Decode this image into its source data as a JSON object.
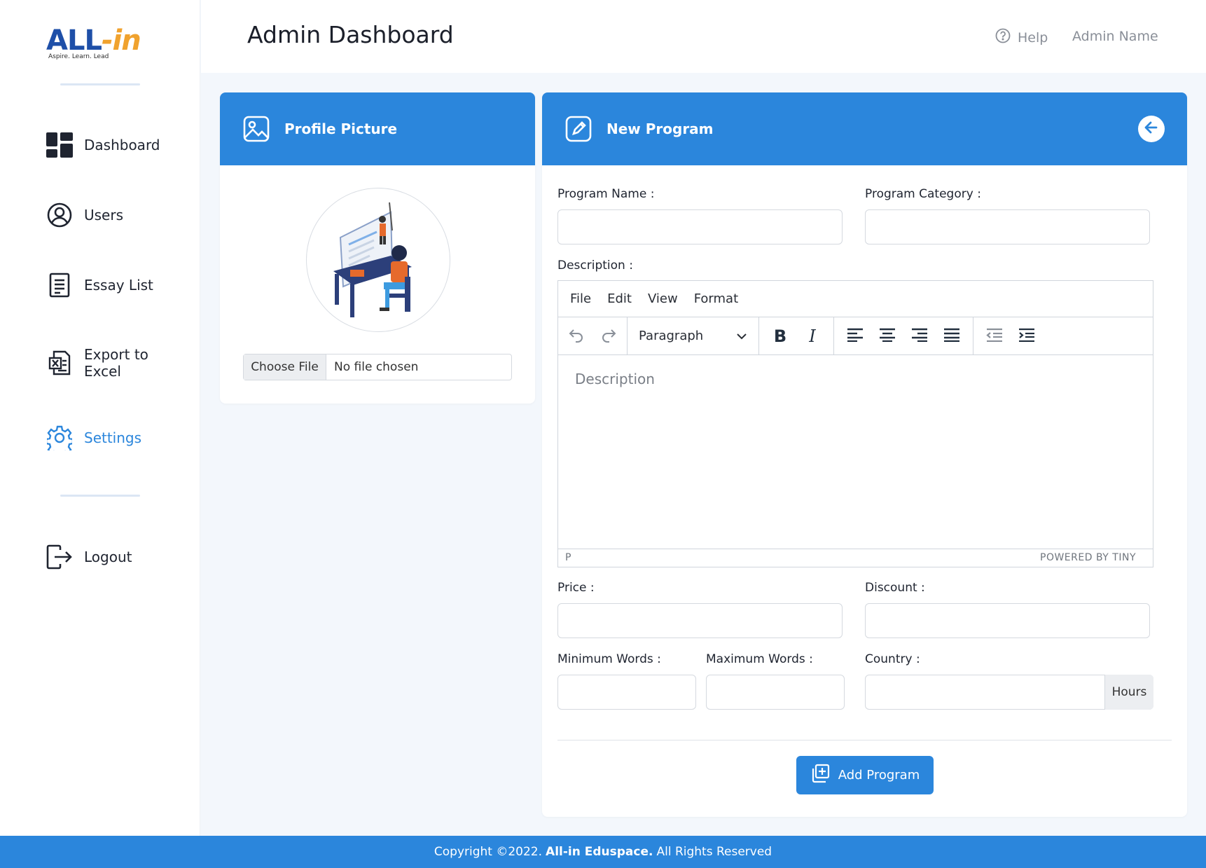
{
  "brand": {
    "logo_main": "ALL",
    "logo_in": "-in",
    "tagline": "Aspire. Learn. Lead"
  },
  "sidebar": {
    "items": [
      {
        "label": "Dashboard",
        "icon": "dashboard-icon"
      },
      {
        "label": "Users",
        "icon": "user-circle-icon"
      },
      {
        "label": "Essay List",
        "icon": "document-list-icon"
      },
      {
        "label": "Export to Excel",
        "icon": "excel-file-icon"
      },
      {
        "label": "Settings",
        "icon": "gear-icon",
        "active": true
      },
      {
        "label": "Logout",
        "icon": "logout-icon"
      }
    ]
  },
  "header": {
    "title": "Admin Dashboard",
    "help": "Help",
    "user": "Admin Name"
  },
  "profile_card": {
    "title": "Profile Picture",
    "file_button": "Choose File",
    "file_status": "No file chosen"
  },
  "program_card": {
    "title": "New Program",
    "labels": {
      "program_name": "Program Name :",
      "program_category": "Program Category :",
      "description": "Description :",
      "price": "Price :",
      "discount": "Discount :",
      "min_words": "Minimum Words :",
      "max_words": "Maximum Words :",
      "country": "Country :"
    },
    "country_addon": "Hours",
    "submit_label": "Add Program"
  },
  "editor": {
    "menu": [
      "File",
      "Edit",
      "View",
      "Format"
    ],
    "block_format": "Paragraph",
    "placeholder": "Description",
    "status_path": "P",
    "powered_by": "POWERED BY TINY"
  },
  "footer": {
    "prefix": "Copyright ©2022.",
    "brand": "All-in Eduspace.",
    "suffix": "All Rights Reserved"
  },
  "colors": {
    "primary": "#2b86dc",
    "brand_blue": "#1e4fa8",
    "brand_orange": "#f0a22e",
    "background": "#f3f7fc"
  }
}
